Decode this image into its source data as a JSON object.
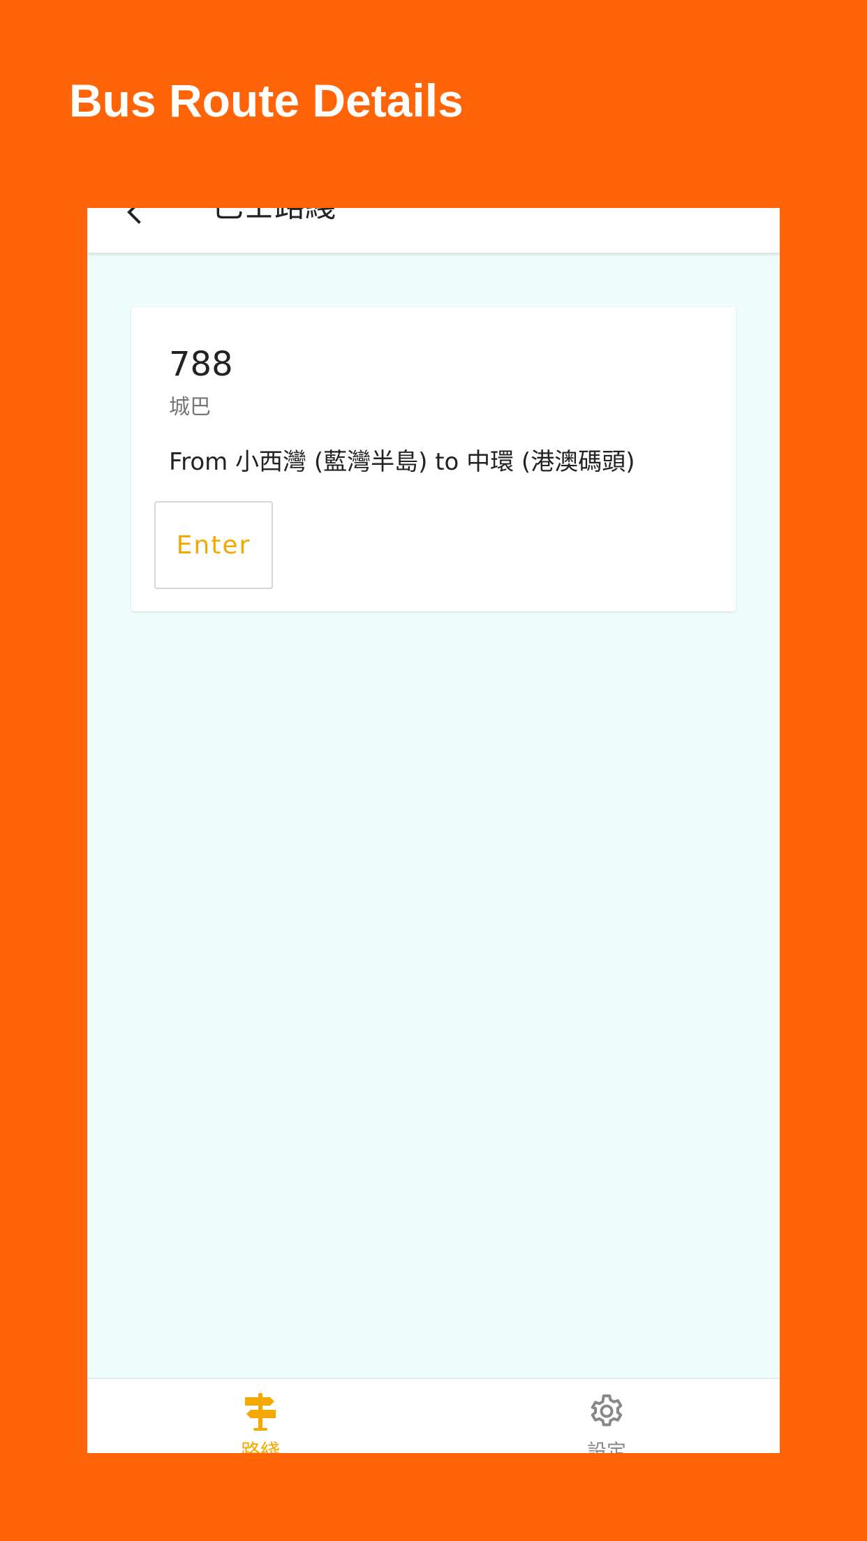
{
  "page": {
    "title": "Bus Route Details"
  },
  "app_bar": {
    "back_icon": "chevron-left-icon",
    "title": "巴士路綫"
  },
  "route_card": {
    "route_number": "788",
    "company": "城巴",
    "description": "From 小西灣 (藍灣半島) to 中環 (港澳碼頭)",
    "enter_label": "Enter"
  },
  "bottom_nav": {
    "items": [
      {
        "label": "路綫",
        "icon": "signpost-icon",
        "active": true
      },
      {
        "label": "設定",
        "icon": "gear-icon",
        "active": false
      }
    ]
  },
  "colors": {
    "background": "#FF6408",
    "accent": "#F5A900",
    "content_background": "#EFFEFD",
    "inactive": "#888888"
  }
}
